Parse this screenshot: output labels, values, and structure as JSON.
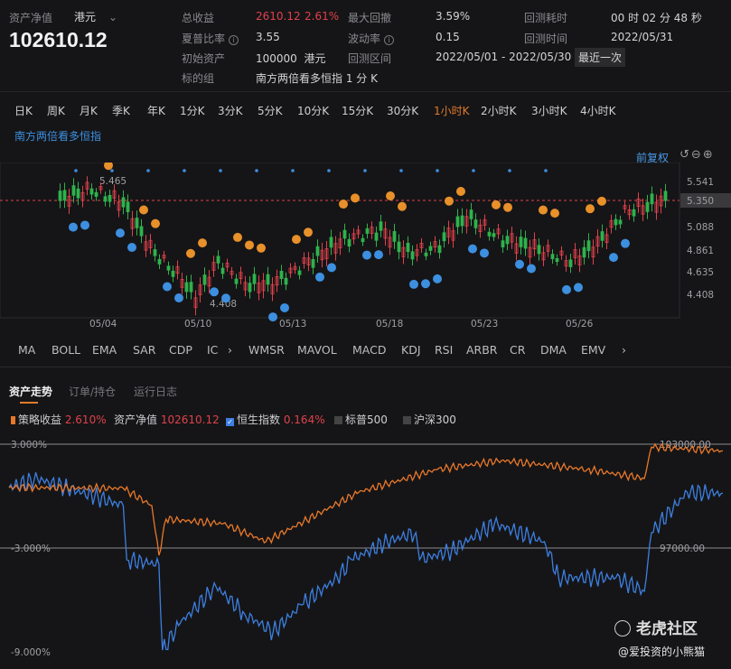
{
  "summary": {
    "nav_label": "资产净值",
    "currency": "港元",
    "nav_value": "102610.12",
    "total_return_label": "总收益",
    "total_return_value": "2610.12",
    "total_return_pct": "2.61%",
    "max_drawdown_label": "最大回撤",
    "max_drawdown_value": "3.59%",
    "backtest_duration_label": "回测耗时",
    "backtest_duration_value": "00 时 02 分 48 秒",
    "sharpe_label": "夏普比率",
    "sharpe_value": "3.55",
    "volatility_label": "波动率",
    "volatility_value": "0.15",
    "backtest_time_label": "回测时间",
    "backtest_time_value": "2022/05/31",
    "initial_label": "初始资产",
    "initial_value": "100000",
    "initial_currency": "港元",
    "range_label": "回测区间",
    "range_value": "2022/05/01 - 2022/05/30",
    "recent_label": "最近一次",
    "target_label": "标的组",
    "target_value": "南方两倍看多恒指 1 分 K"
  },
  "timeframes": [
    "日K",
    "周K",
    "月K",
    "季K",
    "年K",
    "1分K",
    "3分K",
    "5分K",
    "10分K",
    "15分K",
    "30分K",
    "1小时K",
    "2小时K",
    "3小时K",
    "4小时K"
  ],
  "active_timeframe": 11,
  "kline": {
    "symbol": "南方两倍看多恒指",
    "adjust_label": "前复权",
    "price_ticks": [
      "5.541",
      "5.350",
      "5.088",
      "4.861",
      "4.635",
      "4.408"
    ],
    "current_price": "5.350",
    "high_label": "5.465",
    "low_label": "4.408",
    "dates": [
      "05/04",
      "05/10",
      "05/13",
      "05/18",
      "05/23",
      "05/26"
    ]
  },
  "indicators": [
    "MA",
    "BOLL",
    "EMA",
    "SAR",
    "CDP",
    "IC",
    "WMSR",
    "MAVOL",
    "MACD",
    "KDJ",
    "RSI",
    "ARBR",
    "CR",
    "DMA",
    "EMV"
  ],
  "tabs": [
    "资产走势",
    "订单/持仓",
    "运行日志"
  ],
  "legend": {
    "strategy_label": "策略收益",
    "strategy_value": "2.610%",
    "nav_label": "资产净值",
    "nav_value": "102610.12",
    "hsi_label": "恒生指数",
    "hsi_value": "0.164%",
    "sp_label": "标普500",
    "csi_label": "沪深300"
  },
  "equity_chart": {
    "left_ticks": [
      "3.000%",
      "-3.000%",
      "-9.000%"
    ],
    "right_ticks": [
      "103000.00",
      "97000.00"
    ],
    "colors": {
      "strategy": "#e8782a",
      "hsi": "#3d7fe0"
    },
    "strategy": [
      [
        0,
        0.5
      ],
      [
        16,
        0.45
      ],
      [
        20,
        -0.55
      ],
      [
        21,
        -3.42
      ],
      [
        22,
        -1.33
      ],
      [
        30,
        -1.59
      ],
      [
        36,
        -2.63
      ],
      [
        49,
        0.23
      ],
      [
        60,
        1.54
      ],
      [
        69,
        2.06
      ],
      [
        81,
        1.54
      ],
      [
        89,
        1.02
      ],
      [
        90,
        2.84
      ],
      [
        100,
        2.61
      ]
    ],
    "hsi": [
      [
        0,
        0.5
      ],
      [
        4,
        1.0
      ],
      [
        12,
        -0.03
      ],
      [
        16,
        -0.55
      ],
      [
        16.5,
        -3.68
      ],
      [
        21,
        -3.94
      ],
      [
        21.5,
        -8.9
      ],
      [
        24,
        -7.33
      ],
      [
        29,
        -5.24
      ],
      [
        33,
        -6.81
      ],
      [
        37,
        -7.85
      ],
      [
        41,
        -6.29
      ],
      [
        46,
        -4.72
      ],
      [
        48,
        -3.68
      ],
      [
        53,
        -2.63
      ],
      [
        57,
        -2.11
      ],
      [
        57.5,
        -3.68
      ],
      [
        62,
        -3.16
      ],
      [
        68,
        -1.59
      ],
      [
        75,
        -2.63
      ],
      [
        77,
        -4.72
      ],
      [
        85,
        -4.72
      ],
      [
        89,
        -5.5
      ],
      [
        90,
        -2.11
      ],
      [
        95,
        0.23
      ],
      [
        100,
        0.16
      ]
    ]
  },
  "watermark": {
    "brand": "老虎社区",
    "user": "@爱投资的小熊猫"
  }
}
